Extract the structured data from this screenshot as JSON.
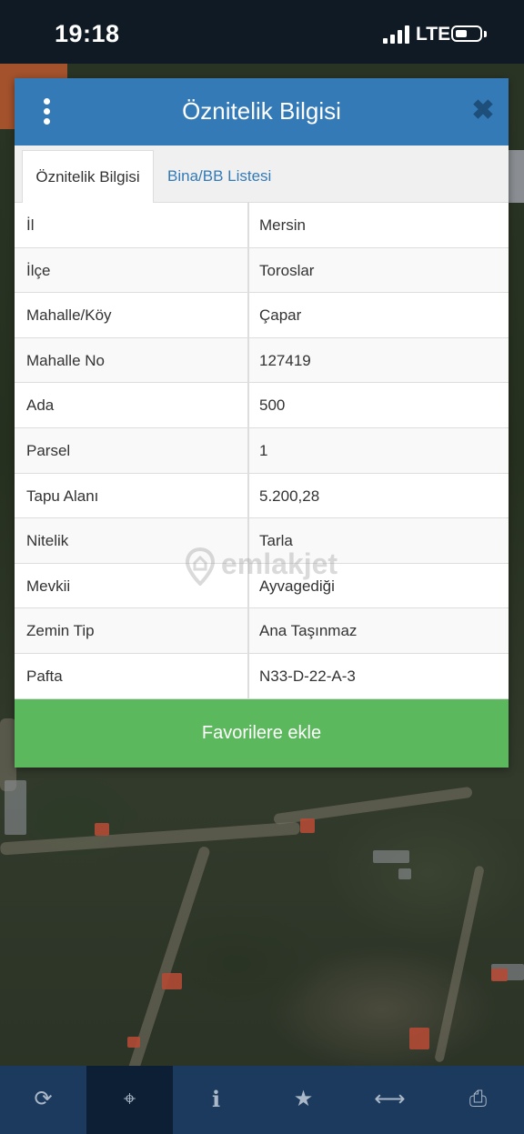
{
  "status_bar": {
    "time": "19:18",
    "network": "LTE"
  },
  "dialog": {
    "title": "Öznitelik Bilgisi",
    "menu_icon": "vertical-dots-icon",
    "close_icon": "close-icon",
    "tabs": [
      {
        "label": "Öznitelik Bilgisi",
        "active": true
      },
      {
        "label": "Bina/BB Listesi",
        "active": false
      }
    ],
    "rows": [
      {
        "key": "İl",
        "value": "Mersin"
      },
      {
        "key": "İlçe",
        "value": "Toroslar"
      },
      {
        "key": "Mahalle/Köy",
        "value": "Çapar"
      },
      {
        "key": "Mahalle No",
        "value": "127419"
      },
      {
        "key": "Ada",
        "value": "500"
      },
      {
        "key": "Parsel",
        "value": "1"
      },
      {
        "key": "Tapu Alanı",
        "value": "5.200,28"
      },
      {
        "key": "Nitelik",
        "value": "Tarla"
      },
      {
        "key": "Mevkii",
        "value": "Ayvagediği"
      },
      {
        "key": "Zemin Tip",
        "value": "Ana Taşınmaz"
      },
      {
        "key": "Pafta",
        "value": "N33-D-22-A-3"
      }
    ],
    "favorite_button": "Favorilere ekle"
  },
  "watermark": "emlakjet",
  "toolbar": {
    "items": [
      {
        "icon": "refresh-icon",
        "active": false
      },
      {
        "icon": "crosshair-icon",
        "active": true
      },
      {
        "icon": "info-icon",
        "active": false
      },
      {
        "icon": "star-icon",
        "active": false
      },
      {
        "icon": "measure-icon",
        "active": false
      },
      {
        "icon": "print-icon",
        "active": false
      }
    ]
  },
  "colors": {
    "header": "#337ab7",
    "favorite": "#5cb85c",
    "toolbar": "#1c3a5e"
  }
}
